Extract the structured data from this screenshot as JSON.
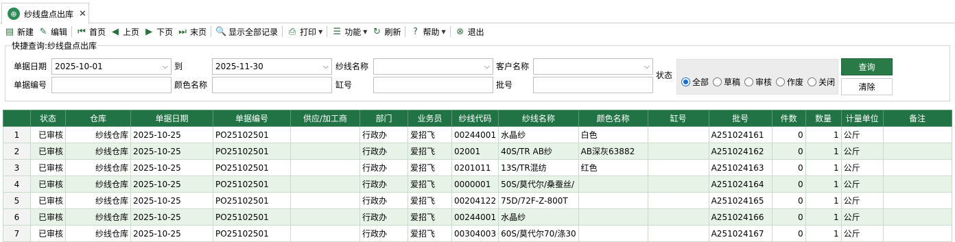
{
  "tab": {
    "title": "纱线盘点出库",
    "close": "✕"
  },
  "toolbar": [
    {
      "key": "new",
      "label": "新建",
      "icon": "grid-doc-icon",
      "glyph": "▤",
      "caret": false
    },
    {
      "key": "edit",
      "label": "编辑",
      "icon": "edit-icon",
      "glyph": "✎",
      "caret": false
    },
    {
      "sep": true
    },
    {
      "key": "first",
      "label": "首页",
      "icon": "first-page-icon",
      "glyph": "⏮",
      "caret": false
    },
    {
      "key": "prev",
      "label": "上页",
      "icon": "prev-page-icon",
      "glyph": "◀",
      "caret": false
    },
    {
      "key": "next",
      "label": "下页",
      "icon": "next-page-icon",
      "glyph": "▶",
      "caret": false
    },
    {
      "key": "last",
      "label": "末页",
      "icon": "last-page-icon",
      "glyph": "⏭",
      "caret": false
    },
    {
      "sep": true
    },
    {
      "key": "showall",
      "label": "显示全部记录",
      "icon": "search-doc-icon",
      "glyph": "🔍",
      "caret": false
    },
    {
      "sep": true
    },
    {
      "key": "print",
      "label": "打印",
      "icon": "printer-icon",
      "glyph": "⎙",
      "caret": true
    },
    {
      "sep": true
    },
    {
      "key": "func",
      "label": "功能",
      "icon": "list-icon",
      "glyph": "☰",
      "caret": true
    },
    {
      "key": "refresh",
      "label": "刷新",
      "icon": "refresh-icon",
      "glyph": "↻",
      "caret": false
    },
    {
      "sep": true
    },
    {
      "key": "help",
      "label": "帮助",
      "icon": "help-icon",
      "glyph": "?",
      "caret": true
    },
    {
      "sep": true
    },
    {
      "key": "exit",
      "label": "退出",
      "icon": "exit-icon",
      "glyph": "⊗",
      "caret": false
    }
  ],
  "query": {
    "title": "快捷查询:纱线盘点出库",
    "date_label": "单据日期",
    "date_from": "2025-10-01",
    "to_label": "到",
    "date_to": "2025-11-30",
    "yarn_name_label": "纱线名称",
    "yarn_name_value": "",
    "customer_label": "客户名称",
    "customer_value": "",
    "status_label": "状态",
    "doc_no_label": "单据编号",
    "doc_no_value": "",
    "color_label": "颜色名称",
    "color_value": "",
    "vat_label": "缸号",
    "vat_value": "",
    "batch_label": "批号",
    "batch_value": "",
    "status_options": [
      "全部",
      "草稿",
      "审核",
      "作废",
      "关闭"
    ],
    "status_selected": 0,
    "query_button": "查询",
    "clear_button": "清除"
  },
  "grid": {
    "columns": [
      "",
      "状态",
      "仓库",
      "单据日期",
      "单据编号",
      "供应/加工商",
      "部门",
      "业务员",
      "纱线代码",
      "纱线名称",
      "颜色名称",
      "缸号",
      "批号",
      "件数",
      "数量",
      "计量单位",
      "备注"
    ],
    "rows": [
      [
        "1",
        "已审核",
        "纱线仓库",
        "2025-10-25",
        "PO25102501",
        "",
        "行政办",
        "爱招飞",
        "00244001",
        "水晶纱",
        "白色",
        "",
        "A251024161",
        "0",
        "1",
        "公斤",
        ""
      ],
      [
        "2",
        "已审核",
        "纱线仓库",
        "2025-10-25",
        "PO25102501",
        "",
        "行政办",
        "爱招飞",
        "02001",
        "40S/TR AB纱",
        "AB深灰63882",
        "",
        "A251024162",
        "0",
        "1",
        "公斤",
        ""
      ],
      [
        "3",
        "已审核",
        "纱线仓库",
        "2025-10-25",
        "PO25102501",
        "",
        "行政办",
        "爱招飞",
        "0201011",
        "13S/TR混纺",
        "红色",
        "",
        "A251024163",
        "0",
        "1",
        "公斤",
        ""
      ],
      [
        "4",
        "已审核",
        "纱线仓库",
        "2025-10-25",
        "PO25102501",
        "",
        "行政办",
        "爱招飞",
        "0000001",
        "50S/莫代尔/桑蚕丝/",
        "",
        "",
        "A251024164",
        "0",
        "1",
        "公斤",
        ""
      ],
      [
        "5",
        "已审核",
        "纱线仓库",
        "2025-10-25",
        "PO25102501",
        "",
        "行政办",
        "爱招飞",
        "00204122",
        "75D/72F-Z-800T",
        "",
        "",
        "A251024165",
        "0",
        "1",
        "公斤",
        ""
      ],
      [
        "6",
        "已审核",
        "纱线仓库",
        "2025-10-25",
        "PO25102501",
        "",
        "行政办",
        "爱招飞",
        "00244001",
        "水晶纱",
        "",
        "",
        "A251024166",
        "0",
        "1",
        "公斤",
        ""
      ],
      [
        "7",
        "已审核",
        "纱线仓库",
        "2025-10-25",
        "PO25102501",
        "",
        "行政办",
        "爱招飞",
        "00304003",
        "60S/莫代尔70/涤30",
        "",
        "",
        "A251024167",
        "0",
        "1",
        "公斤",
        ""
      ]
    ]
  }
}
